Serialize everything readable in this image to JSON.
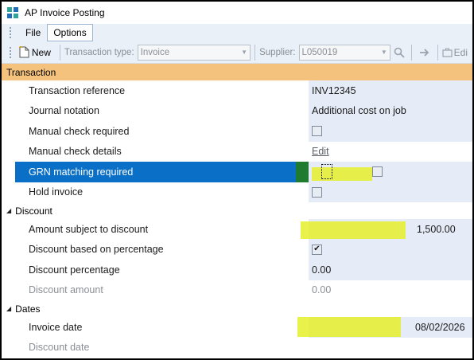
{
  "window": {
    "title": "AP Invoice Posting"
  },
  "menu": {
    "items": [
      {
        "label": "File"
      },
      {
        "label": "Options"
      }
    ]
  },
  "toolbar": {
    "new_label": "New",
    "transaction_type_label": "Transaction type:",
    "transaction_type_value": "Invoice",
    "supplier_label": "Supplier:",
    "supplier_value": "L050019",
    "edit_label": "Edi"
  },
  "grid": {
    "transaction": {
      "category": "Transaction",
      "transaction_reference": {
        "label": "Transaction reference",
        "value": "INV12345"
      },
      "journal_notation": {
        "label": "Journal notation",
        "value": "Additional cost on job"
      },
      "manual_check_required": {
        "label": "Manual check required",
        "checked": false
      },
      "manual_check_details": {
        "label": "Manual check details",
        "value": "Edit"
      },
      "grn_matching_required": {
        "label": "GRN matching required",
        "checked": false
      },
      "hold_invoice": {
        "label": "Hold invoice",
        "checked": false
      }
    },
    "discount": {
      "category": "Discount",
      "amount_subject": {
        "label": "Amount subject to discount",
        "value": "1,500.00"
      },
      "based_on_percentage": {
        "label": "Discount based on percentage",
        "checked": true
      },
      "percentage": {
        "label": "Discount percentage",
        "value": "0.00"
      },
      "amount": {
        "label": "Discount amount",
        "value": "0.00"
      }
    },
    "dates": {
      "category": "Dates",
      "invoice_date": {
        "label": "Invoice date",
        "value": "08/02/2026"
      },
      "discount_date": {
        "label": "Discount date",
        "value": ""
      }
    }
  },
  "colors": {
    "category_header": "#f5c27d",
    "selection": "#0a6fc7",
    "highlight": "#e5ee2c",
    "value_background": "#e6ecf7"
  }
}
